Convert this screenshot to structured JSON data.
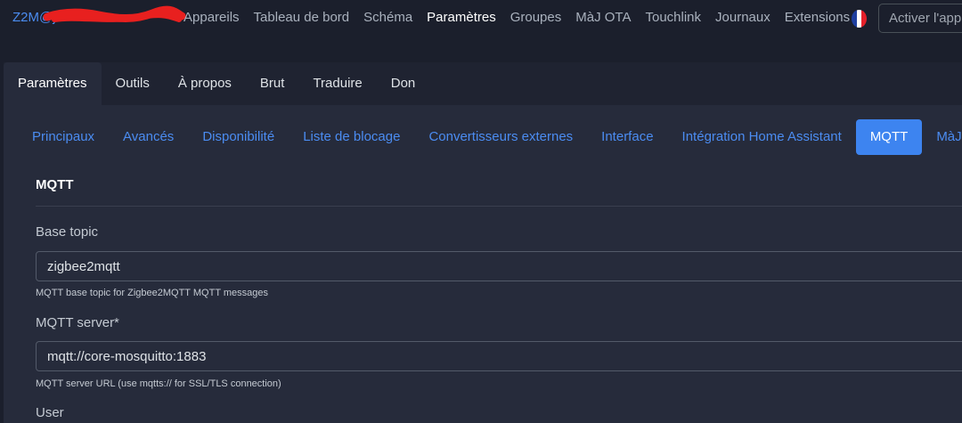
{
  "navbar": {
    "brand": "Z2M@j",
    "links": [
      {
        "label": "Appareils",
        "active": false
      },
      {
        "label": "Tableau de bord",
        "active": false
      },
      {
        "label": "Schéma",
        "active": false
      },
      {
        "label": "Paramètres",
        "active": true
      },
      {
        "label": "Groupes",
        "active": false
      },
      {
        "label": "MàJ OTA",
        "active": false
      },
      {
        "label": "Touchlink",
        "active": false
      },
      {
        "label": "Journaux",
        "active": false
      },
      {
        "label": "Extensions",
        "active": false
      }
    ],
    "language_icon": "france-flag-icon",
    "search_placeholder": "Activer l'app"
  },
  "card": {
    "tabs": [
      {
        "label": "Paramètres",
        "active": true
      },
      {
        "label": "Outils",
        "active": false
      },
      {
        "label": "À propos",
        "active": false
      },
      {
        "label": "Brut",
        "active": false
      },
      {
        "label": "Traduire",
        "active": false
      },
      {
        "label": "Don",
        "active": false
      }
    ],
    "sub_tabs": [
      {
        "label": "Principaux",
        "active": false
      },
      {
        "label": "Avancés",
        "active": false
      },
      {
        "label": "Disponibilité",
        "active": false
      },
      {
        "label": "Liste de blocage",
        "active": false
      },
      {
        "label": "Convertisseurs externes",
        "active": false
      },
      {
        "label": "Interface",
        "active": false
      },
      {
        "label": "Intégration Home Assistant",
        "active": false
      },
      {
        "label": "MQTT",
        "active": true
      },
      {
        "label": "MàJ OTA",
        "active": false
      }
    ],
    "section_title": "MQTT",
    "fields": {
      "base_topic": {
        "label": "Base topic",
        "value": "zigbee2mqtt",
        "help": "MQTT base topic for Zigbee2MQTT MQTT messages"
      },
      "server": {
        "label": "MQTT server*",
        "value": "mqtt://core-mosquitto:1883",
        "help": "MQTT server URL (use mqtts:// for SSL/TLS connection)"
      },
      "user": {
        "label": "User"
      }
    }
  },
  "colors": {
    "background": "#1b1f2c",
    "card": "#262b3b",
    "accent": "#3d84f0",
    "link": "#4b8cf1",
    "redaction": "#e8201f"
  }
}
